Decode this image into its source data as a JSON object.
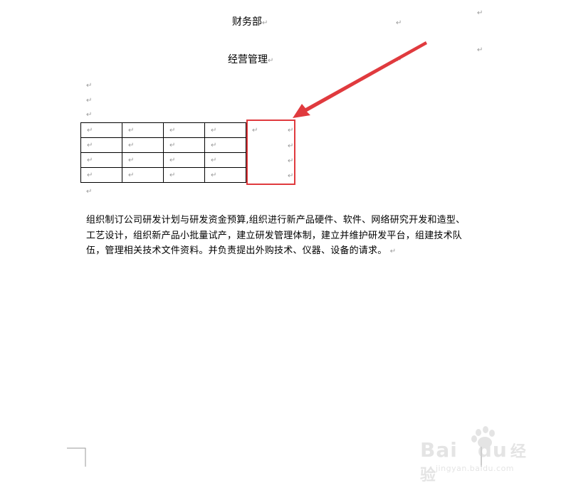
{
  "document": {
    "heading1": "财务部",
    "heading2": "经营管理",
    "paragraph_lines": [
      "组织制订公司研发计划与研发资金预算,组织进行新产品硬件、软件、网络研究开发和造型、",
      "工艺设计，组织新产品小批量试产，建立研发管理体制，建立并维护研发平台，组建技术队",
      "伍，管理相关技术文件资料。并负责提出外购技术、仪器、设备的请求。"
    ],
    "paragraph_mark": "↵"
  },
  "table": {
    "rows": 4,
    "cols": 4,
    "cell_mark": "↵"
  },
  "annotation": {
    "highlight_color": "#e03a3e",
    "arrow_color": "#e03a3e"
  },
  "watermark": {
    "brand": "Bai",
    "brand2": "du",
    "suffix": "经验",
    "url": "jingyan.baidu.com"
  }
}
